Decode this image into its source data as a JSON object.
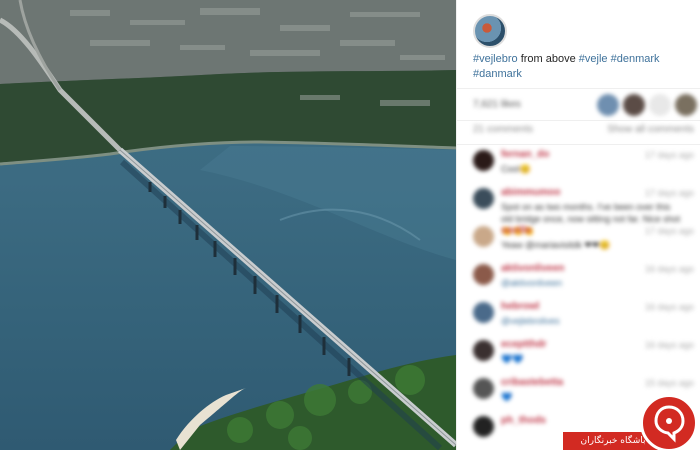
{
  "post": {
    "caption": {
      "tag1": "#vejlebro",
      "text": " from above ",
      "tag2": "#vejle",
      "tag3": "#denmark",
      "tag4": "#danmark"
    },
    "likes_text": "7,621 likes",
    "comments_count": "21 comments",
    "show_all": "Show all comments"
  },
  "comments": [
    {
      "user": "fernan_do",
      "time": "17 days ago",
      "text": "Cool😊",
      "style": "plain",
      "avatar_color": "#2a1a18"
    },
    {
      "user": "abimmumoo",
      "time": "17 days ago",
      "text": "Spot on as two months. I've been over this old bridge once, now sitting not far. Nice shot 👏👏👏",
      "style": "plain",
      "avatar_color": "#3b4d5b"
    },
    {
      "user": "saville",
      "time": "17 days ago",
      "text": "Yeaw @mariavisitdk ❤❤😊",
      "style": "plain",
      "avatar_color": "#c9a889"
    },
    {
      "user": "aktivonliveen",
      "time": "16 days ago",
      "text": "@aktivonliveen",
      "style": "link",
      "avatar_color": "#8b5a4a"
    },
    {
      "user": "hebrowl",
      "time": "16 days ago",
      "text": "@vejlebrolives",
      "style": "link",
      "avatar_color": "#4a6a8a"
    },
    {
      "user": "eceptthdr",
      "time": "16 days ago",
      "text": "💙💙",
      "style": "plain",
      "avatar_color": "#3a3030"
    },
    {
      "user": "cribastebetta",
      "time": "15 days ago",
      "text": "💙",
      "style": "plain",
      "avatar_color": "#555555"
    },
    {
      "user": "ph_thods",
      "time": "15 days ago",
      "text": "",
      "style": "plain",
      "avatar_color": "#222222"
    }
  ],
  "likers": [
    "#6f8fb0",
    "#5b4c46",
    "#e8e8e8",
    "#7a7060"
  ],
  "watermark": {
    "banner_text": "باشگاه خبرنگاران"
  },
  "colors": {
    "hashtag": "#3f729b",
    "username": "#c0394a",
    "watermark_red": "#d22a22"
  }
}
